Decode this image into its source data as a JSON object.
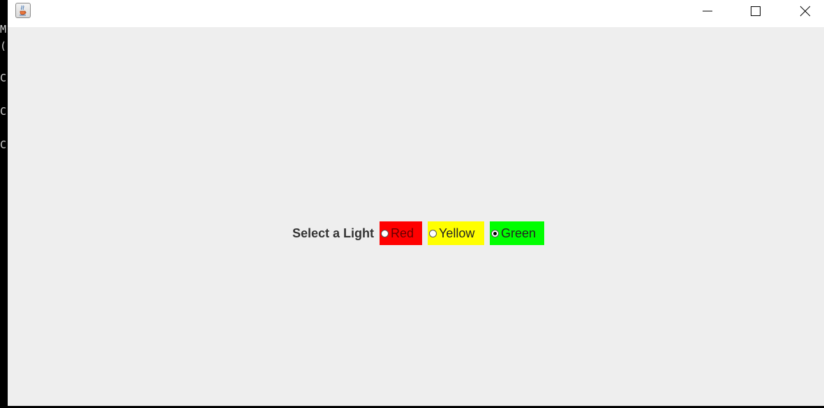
{
  "terminal": {
    "lines": [
      "M",
      "(",
      "C",
      "C",
      "C"
    ]
  },
  "window": {
    "title": "",
    "icon": "java-coffee-cup-icon",
    "controls": {
      "minimize": "minimize-icon",
      "maximize": "maximize-icon",
      "close": "close-icon"
    }
  },
  "panel": {
    "label": "Select a Light",
    "options": [
      {
        "label": "Red",
        "color": "#ff0000",
        "selected": false
      },
      {
        "label": "Yellow",
        "color": "#ffff00",
        "selected": false
      },
      {
        "label": "Green",
        "color": "#00ff00",
        "selected": true
      }
    ]
  }
}
